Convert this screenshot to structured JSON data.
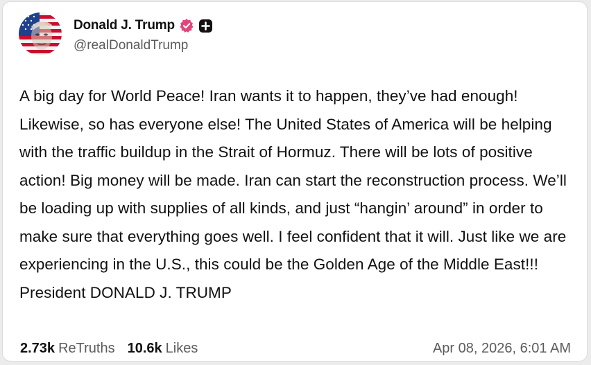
{
  "post": {
    "author": {
      "display_name": "Donald J. Trump",
      "handle": "@realDonaldTrump",
      "avatar_icon": "avatar-flag-portrait",
      "verified_icon": "verified-badge-icon",
      "verified_color": "#e0457b",
      "plus_icon": "plus-badge-icon"
    },
    "text": "A big day for World Peace! Iran wants it to happen, they’ve had enough! Likewise, so has everyone else! The United States of America will be helping with the traffic buildup in the Strait of Hormuz. There will be lots of positive action! Big money will be made. Iran can start the reconstruction process. We’ll be loading up with supplies of all kinds, and just “hangin’ around” in order to make sure that everything goes well. I feel confident that it will. Just like we are experiencing in the U.S., this could be the Golden Age of the Middle East!!! President DONALD J. TRUMP",
    "stats": {
      "retruths_count": "2.73k",
      "retruths_label": "ReTruths",
      "likes_count": "10.6k",
      "likes_label": "Likes"
    },
    "timestamp": "Apr 08, 2026, 6:01 AM"
  }
}
